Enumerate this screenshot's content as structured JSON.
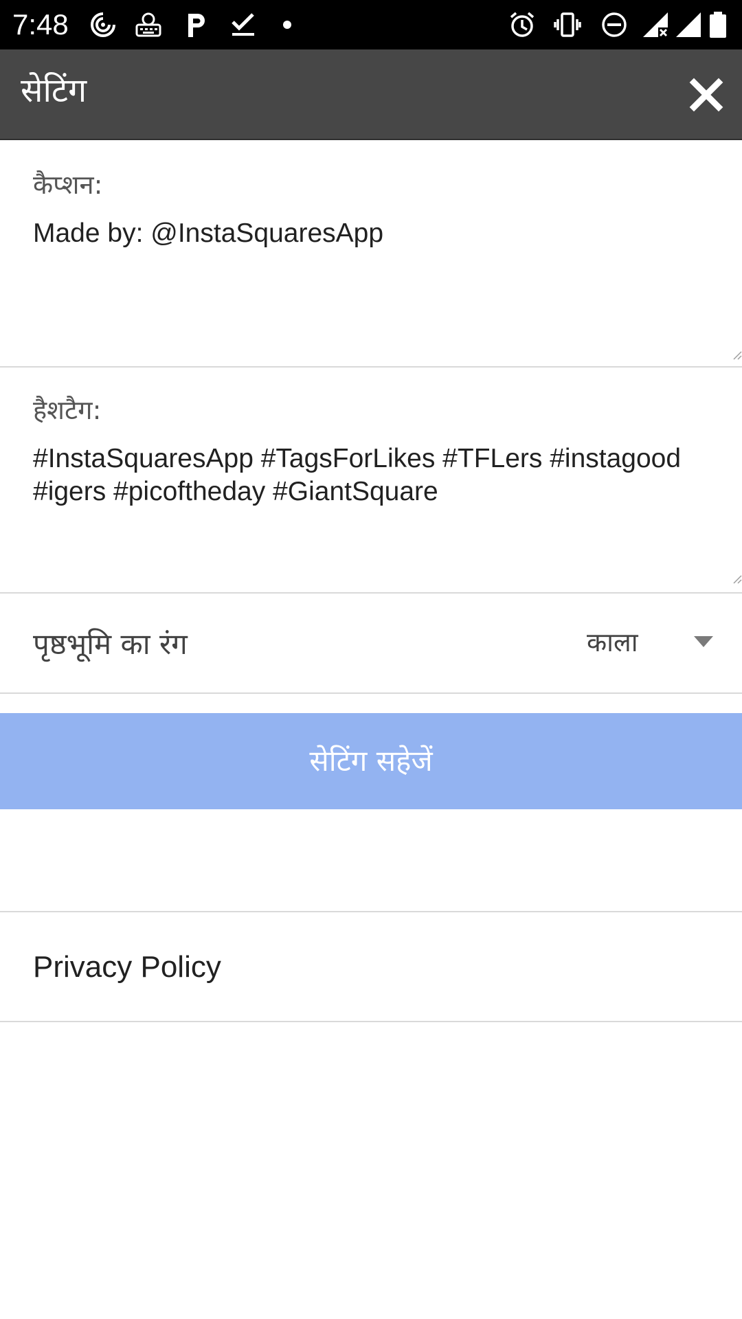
{
  "status_bar": {
    "time": "7:48",
    "left_icons": [
      "swirl-app-icon",
      "keyboard-app-icon",
      "parking-app-icon",
      "task-check-icon",
      "notification-dot-icon"
    ],
    "right_icons": [
      "alarm-icon",
      "vibrate-icon",
      "do-not-disturb-icon",
      "signal-no-data-icon",
      "signal-icon",
      "battery-icon"
    ]
  },
  "toolbar": {
    "title": "सेटिंग",
    "close_icon": "close-icon"
  },
  "caption": {
    "label": "कैप्शन:",
    "value": "Made by: @InstaSquaresApp"
  },
  "hashtags": {
    "label": "हैशटैग:",
    "value": "#InstaSquaresApp #TagsForLikes #TFLers #instagood #igers #picoftheday #GiantSquare"
  },
  "background": {
    "label": "पृष्ठभूमि का रंग",
    "selected": "काला",
    "caret_icon": "dropdown-caret-icon"
  },
  "save_button": {
    "label": "सेटिंग सहेजें",
    "color": "#93b3f1"
  },
  "privacy": {
    "label": "Privacy Policy"
  },
  "colors": {
    "toolbar": "#474747",
    "status_bar": "#000000",
    "divider": "#d9d9d9"
  }
}
